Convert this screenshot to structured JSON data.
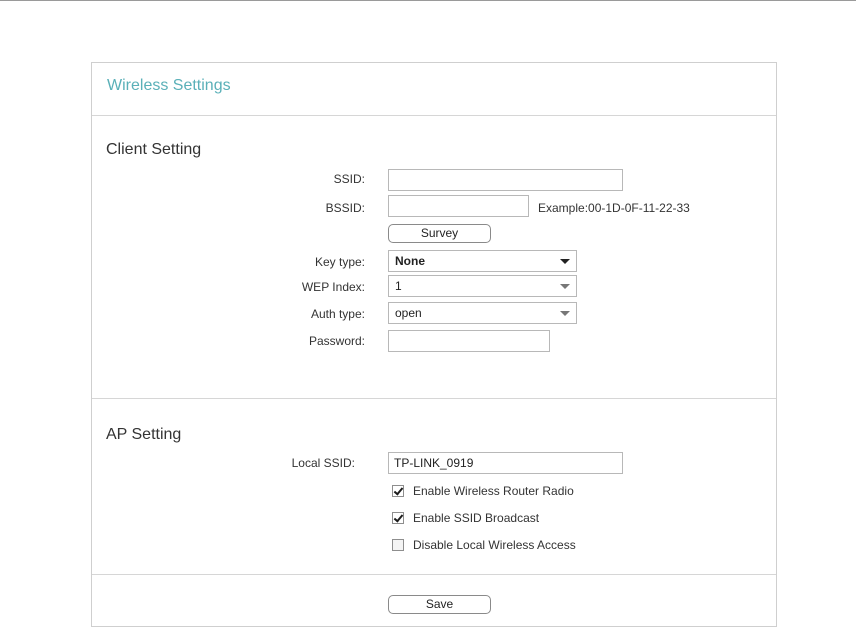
{
  "panel": {
    "title": "Wireless Settings"
  },
  "client": {
    "heading": "Client Setting",
    "ssid": {
      "label": "SSID:",
      "value": ""
    },
    "bssid": {
      "label": "BSSID:",
      "value": "",
      "hint": "Example:00-1D-0F-11-22-33"
    },
    "survey_label": "Survey",
    "key_type": {
      "label": "Key type:",
      "value": "None"
    },
    "wep_index": {
      "label": "WEP Index:",
      "value": "1"
    },
    "auth_type": {
      "label": "Auth type:",
      "value": "open"
    },
    "password": {
      "label": "Password:",
      "value": ""
    }
  },
  "ap": {
    "heading": "AP Setting",
    "local_ssid": {
      "label": "Local SSID:",
      "value": "TP-LINK_0919"
    },
    "options": [
      {
        "label": "Enable Wireless Router Radio",
        "checked": true
      },
      {
        "label": "Enable SSID Broadcast",
        "checked": true
      },
      {
        "label": "Disable Local Wireless Access",
        "checked": false
      }
    ]
  },
  "save_label": "Save",
  "icons": {
    "dropdown": "chevron-down-icon",
    "check": "checkmark-icon"
  },
  "colors": {
    "accent": "#5ab0b8",
    "border": "#d6d6d6"
  }
}
